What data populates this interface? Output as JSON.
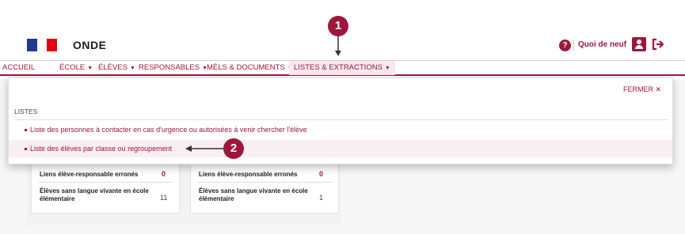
{
  "header": {
    "app_name": "ONDE",
    "help_glyph": "?",
    "whats_new": "Quoi de neuf"
  },
  "nav": {
    "items": [
      {
        "label": "ACCUEIL",
        "has_caret": false
      },
      {
        "label": "ÉCOLE",
        "has_caret": true
      },
      {
        "label": "ÉLÈVES",
        "has_caret": true
      },
      {
        "label": "RESPONSABLES",
        "has_caret": true
      },
      {
        "label": "MÉLS & DOCUMENTS",
        "has_caret": true
      },
      {
        "label": "LISTES & EXTRACTIONS",
        "has_caret": true,
        "active": true
      }
    ],
    "caret": "▼"
  },
  "panel": {
    "close_label": "FERMER ✕",
    "section_label": "LISTES",
    "items": [
      {
        "label": "Liste des personnes à contacter en cas d'urgence ou autorisées à venir chercher l'élève"
      },
      {
        "label": "Liste des élèves par classe ou regroupement"
      }
    ]
  },
  "dashboard": {
    "cards": [
      {
        "rows": [
          {
            "label": "Liens élève-responsable erronés",
            "value": "0"
          },
          {
            "label": "Élèves sans langue vivante en école élémentaire",
            "value": "11"
          }
        ]
      },
      {
        "rows": [
          {
            "label": "Liens élève-responsable erronés",
            "value": "0"
          },
          {
            "label": "Élèves sans langue vivante en école élémentaire",
            "value": "1"
          }
        ]
      }
    ]
  },
  "callouts": [
    {
      "number": "1"
    },
    {
      "number": "2"
    }
  ],
  "colors": {
    "accent": "#a0163a",
    "highlight": "#f9eef1",
    "flag_blue": "#1f3a93",
    "flag_red": "#e1000f"
  }
}
